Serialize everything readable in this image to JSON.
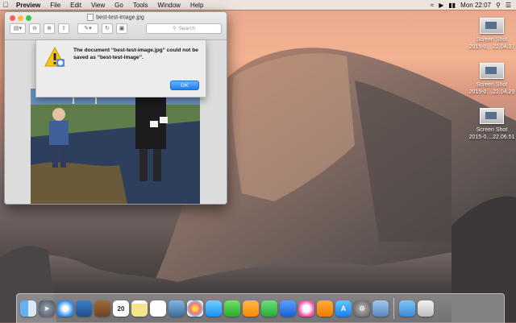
{
  "menubar": {
    "apple": "",
    "app_name": "Preview",
    "items": [
      "File",
      "Edit",
      "View",
      "Go",
      "Tools",
      "Window",
      "Help"
    ],
    "clock": "Mon 22:07"
  },
  "window": {
    "title": "best-test-image.jpg",
    "search_placeholder": "Search"
  },
  "dialog": {
    "message": "The document “best-test-image.jpg” could not be saved as “best-test-image”.",
    "ok_label": "OK"
  },
  "desktop_icons": [
    {
      "line1": "Screen Shot",
      "line2": "2015-0....22.04.37"
    },
    {
      "line1": "Screen Shot",
      "line2": "2015-0....22.04.29"
    },
    {
      "line1": "Screen Shot",
      "line2": "2015-0....22.06.51"
    }
  ],
  "dock_items": [
    "finder",
    "launchpad",
    "safari",
    "mail-stamp",
    "contacts",
    "calendar",
    "notes",
    "reminders",
    "photo-viewer",
    "photos",
    "messages-bubble",
    "facetime",
    "pages",
    "numbers",
    "keynote",
    "itunes",
    "ibooks",
    "app-store",
    "system-preferences",
    "preview",
    "downloads-folder",
    "trash"
  ],
  "calendar_day": "20"
}
